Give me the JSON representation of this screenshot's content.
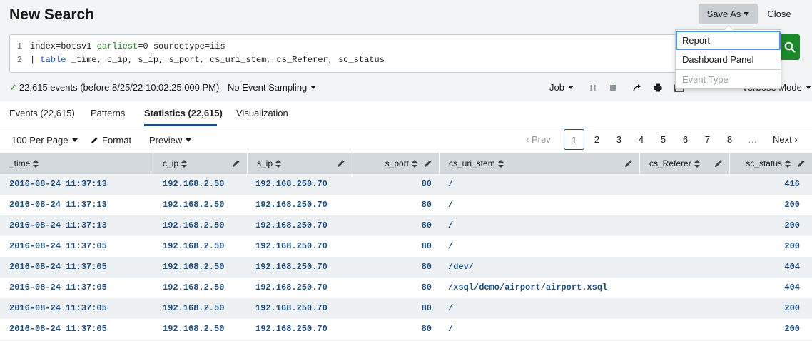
{
  "header": {
    "title": "New Search",
    "save_as_label": "Save As",
    "close_label": "Close"
  },
  "search": {
    "line_numbers": [
      "1",
      "2"
    ],
    "line1": {
      "plain1": "index=botsv1 ",
      "keyword1": "earliest",
      "plain2": "=0 sourcetype=iis"
    },
    "line2": {
      "pipe": "| ",
      "command": "table",
      "args": " _time, c_ip, s_ip, s_port, cs_uri_stem, cs_Referer, sc_status"
    }
  },
  "status": {
    "event_count": "22,615 events (before 8/25/22 10:02:25.000 PM)",
    "sampling_label": "No Event Sampling",
    "job_label": "Job",
    "mode_label": "Verbose Mode"
  },
  "tabs": [
    {
      "label": "Events (22,615)"
    },
    {
      "label": "Patterns"
    },
    {
      "label": "Statistics (22,615)"
    },
    {
      "label": "Visualization"
    }
  ],
  "toolbar": {
    "per_page_label": "100 Per Page",
    "format_label": "Format",
    "preview_label": "Preview"
  },
  "pager": {
    "prev_label": "Prev",
    "pages": [
      "1",
      "2",
      "3",
      "4",
      "5",
      "6",
      "7",
      "8"
    ],
    "current_page": "1",
    "ellipsis": "…",
    "next_label": "Next"
  },
  "table": {
    "columns": [
      "_time",
      "c_ip",
      "s_ip",
      "s_port",
      "cs_uri_stem",
      "cs_Referer",
      "sc_status"
    ],
    "rows": [
      [
        "2016-08-24 11:37:13",
        "192.168.2.50",
        "192.168.250.70",
        "80",
        "/",
        "",
        "416"
      ],
      [
        "2016-08-24 11:37:13",
        "192.168.2.50",
        "192.168.250.70",
        "80",
        "/",
        "",
        "200"
      ],
      [
        "2016-08-24 11:37:13",
        "192.168.2.50",
        "192.168.250.70",
        "80",
        "/",
        "",
        "200"
      ],
      [
        "2016-08-24 11:37:05",
        "192.168.2.50",
        "192.168.250.70",
        "80",
        "/",
        "",
        "200"
      ],
      [
        "2016-08-24 11:37:05",
        "192.168.2.50",
        "192.168.250.70",
        "80",
        "/dev/",
        "",
        "404"
      ],
      [
        "2016-08-24 11:37:05",
        "192.168.2.50",
        "192.168.250.70",
        "80",
        "/xsql/demo/airport/airport.xsql",
        "",
        "404"
      ],
      [
        "2016-08-24 11:37:05",
        "192.168.2.50",
        "192.168.250.70",
        "80",
        "/",
        "",
        "200"
      ],
      [
        "2016-08-24 11:37:05",
        "192.168.2.50",
        "192.168.250.70",
        "80",
        "/",
        "",
        "200"
      ]
    ]
  },
  "save_as_menu": {
    "items": [
      {
        "label": "Report",
        "enabled": true
      },
      {
        "label": "Dashboard Panel",
        "enabled": true
      },
      {
        "label": "Event Type",
        "enabled": false
      }
    ]
  },
  "colors": {
    "accent": "#1c4d80",
    "search_button": "#1a8929",
    "success": "#2a8a2a"
  }
}
